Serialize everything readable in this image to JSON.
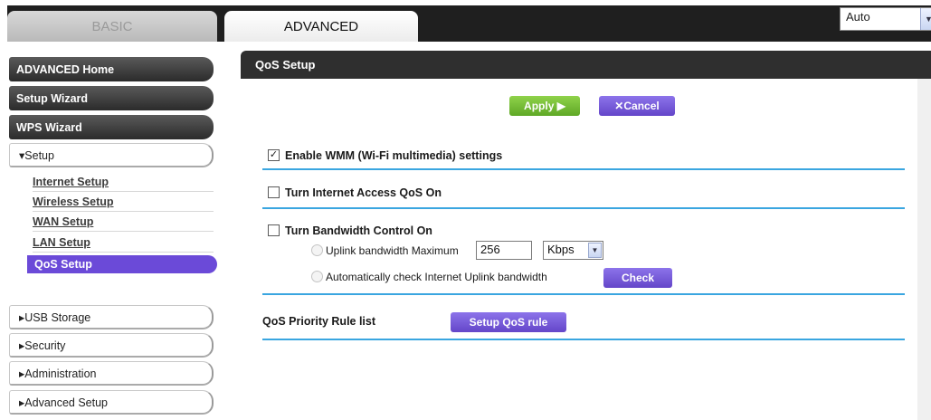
{
  "tabs": {
    "basic": "BASIC",
    "advanced": "ADVANCED"
  },
  "language": {
    "selected": "Auto"
  },
  "sidebar": {
    "advanced_home": "ADVANCED Home",
    "setup_wizard": "Setup Wizard",
    "wps_wizard": "WPS Wizard",
    "setup": "▾Setup",
    "sub_items": [
      "Internet Setup",
      "Wireless Setup",
      "WAN Setup",
      "LAN Setup"
    ],
    "active_item": "QoS Setup",
    "usb_storage": "▸USB Storage",
    "security": "▸Security",
    "administration": "▸Administration",
    "advanced_setup": "▸Advanced Setup"
  },
  "main": {
    "title": "QoS Setup",
    "apply_label": "Apply ▶",
    "cancel_label": "✕Cancel",
    "enable_wmm": {
      "label": "Enable WMM (Wi-Fi multimedia) settings",
      "checked": true,
      "mark": "✓"
    },
    "internet_qos": {
      "label": "Turn Internet Access QoS On",
      "checked": false
    },
    "bandwidth_control": {
      "label": "Turn Bandwidth Control On",
      "checked": false
    },
    "uplink_label": "Uplink bandwidth Maximum",
    "uplink_value": "256",
    "unit_selected": "Kbps",
    "auto_check_label": "Automatically check Internet Uplink bandwidth",
    "check_label": "Check",
    "rule_list_label": "QoS Priority Rule list",
    "setup_rule_label": "Setup QoS rule"
  },
  "colors": {
    "accent_purple": "#6b4ad8",
    "apply_green": "#6fb530",
    "divider_blue": "#3aa6e0",
    "header_dark": "#2f2f2f"
  }
}
